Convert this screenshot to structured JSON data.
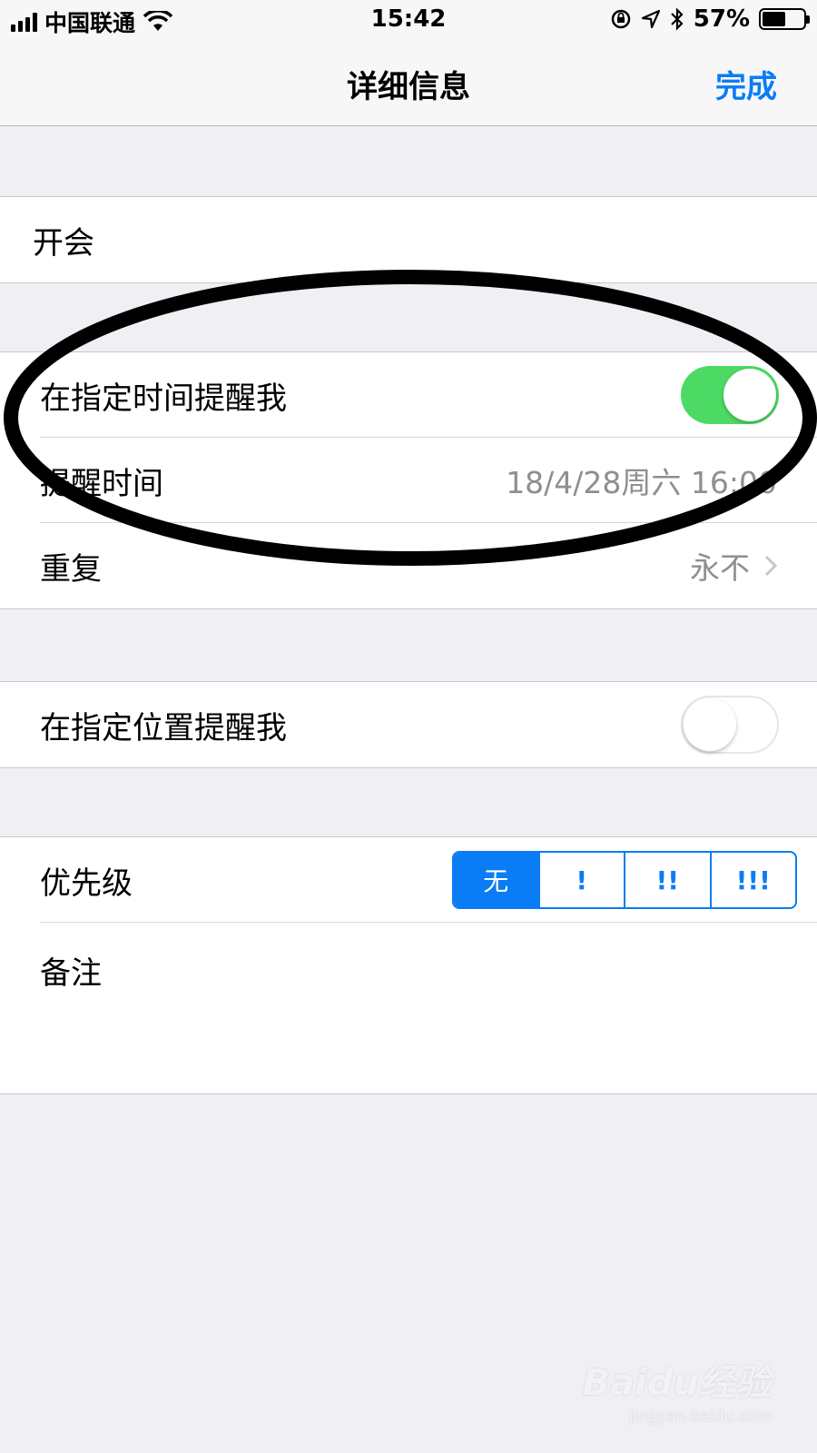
{
  "status_bar": {
    "carrier": "中国联通",
    "time": "15:42",
    "battery": "57%",
    "battery_level": 0.57,
    "icons": [
      "signal-icon",
      "wifi-icon",
      "rotation-lock-icon",
      "location-icon",
      "bluetooth-icon",
      "battery-icon"
    ]
  },
  "nav": {
    "title": "详细信息",
    "done": "完成"
  },
  "reminder": {
    "title": "开会"
  },
  "time_group": {
    "remind_at_time_label": "在指定时间提醒我",
    "remind_at_time_on": true,
    "alarm_label": "提醒时间",
    "alarm_value": "18/4/28周六 16:00",
    "repeat_label": "重复",
    "repeat_value": "永不"
  },
  "location_group": {
    "remind_at_location_label": "在指定位置提醒我",
    "remind_at_location_on": false
  },
  "details_group": {
    "priority_label": "优先级",
    "priority_options": [
      "无",
      "!",
      "!!",
      "!!!"
    ],
    "priority_selected": "无",
    "notes_label": "备注"
  },
  "watermark": {
    "logo": "Baidu经验",
    "url": "jingyan.baidu.com"
  },
  "colors": {
    "accent": "#0a7cf5",
    "toggle_on": "#4cd964",
    "background": "#efeff4",
    "annotation": "#000000"
  }
}
